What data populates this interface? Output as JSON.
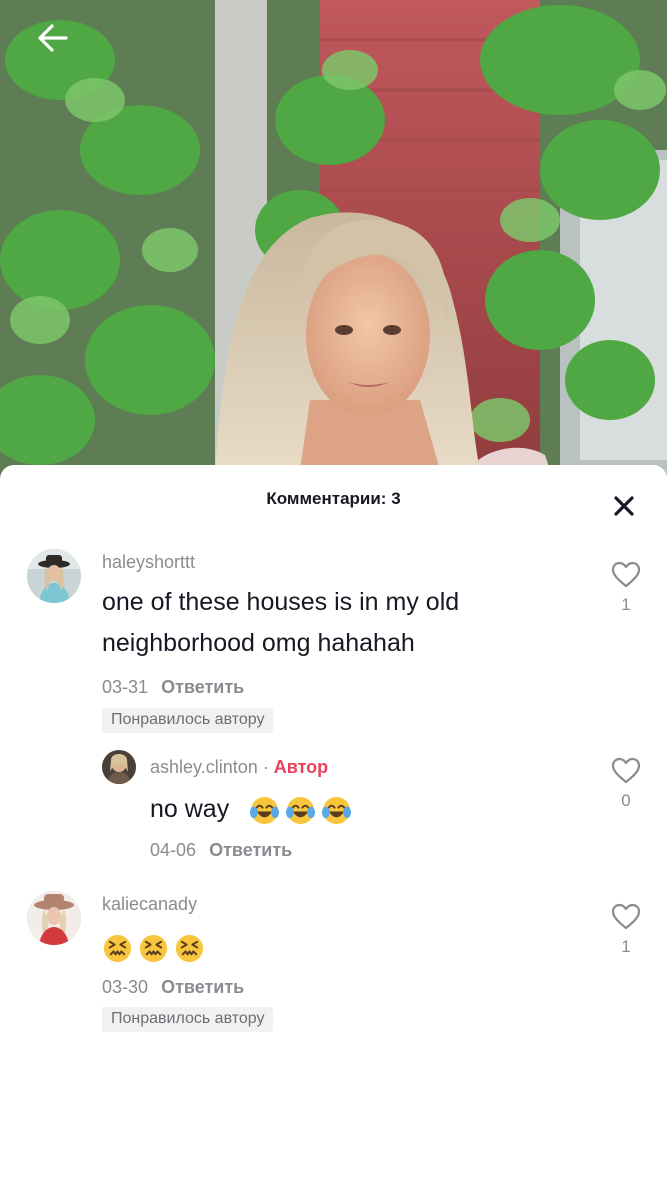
{
  "header": {
    "back_icon": "arrow-left-icon",
    "video_description": "video-background-image"
  },
  "comments_panel": {
    "title": "Комментарии: 3",
    "close_icon": "close-icon"
  },
  "comments": [
    {
      "username": "haleyshorttt",
      "text_line1": "one of these houses is in my old",
      "text_line2": "neighborhood omg hahahah",
      "date": "03-31",
      "reply_label": "Ответить",
      "liked_by_author": "Понравилось автору",
      "likes": "1"
    },
    {
      "username": "ashley.clinton",
      "separator": "·",
      "author_label": "Автор",
      "text": "no way",
      "emoji": [
        "tears-of-joy-emoji",
        "tears-of-joy-emoji",
        "tears-of-joy-emoji"
      ],
      "date": "04-06",
      "reply_label": "Ответить",
      "likes": "0"
    },
    {
      "username": "kaliecanady",
      "emoji": [
        "confounded-face-emoji",
        "confounded-face-emoji",
        "confounded-face-emoji"
      ],
      "date": "03-30",
      "reply_label": "Ответить",
      "liked_by_author": "Понравилось автору",
      "likes": "1"
    }
  ],
  "colors": {
    "author_accent": "#e8415a",
    "muted_text": "#8a8b91",
    "primary_text": "#161823"
  }
}
